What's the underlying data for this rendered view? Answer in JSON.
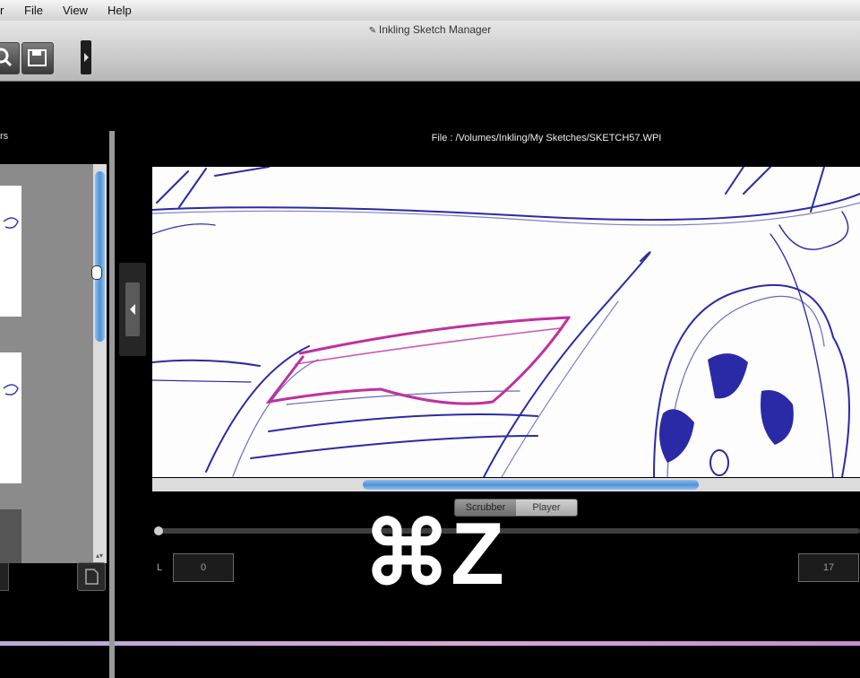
{
  "menubar": {
    "items": [
      "r",
      "File",
      "View",
      "Help"
    ]
  },
  "window": {
    "title": "Inkling Sketch Manager"
  },
  "toolbar": {
    "buttons": [
      "zoom-icon",
      "save-icon",
      "tool-icon"
    ]
  },
  "left_panel": {
    "header_fragment": "rs",
    "thumbnail_count": 3
  },
  "file_path": "File : /Volumes/Inkling/My Sketches/SKETCH57.WPI",
  "playback": {
    "segments": {
      "scrubber": "Scrubber",
      "player": "Player"
    },
    "left_label": "L",
    "start_value": "0",
    "end_value": "17"
  },
  "overlay": {
    "shortcut": "⌘Z"
  },
  "colors": {
    "stroke_blue": "#2a2aa6",
    "stroke_magenta": "#c0309e",
    "scroll_blue": "#4f92d8"
  }
}
